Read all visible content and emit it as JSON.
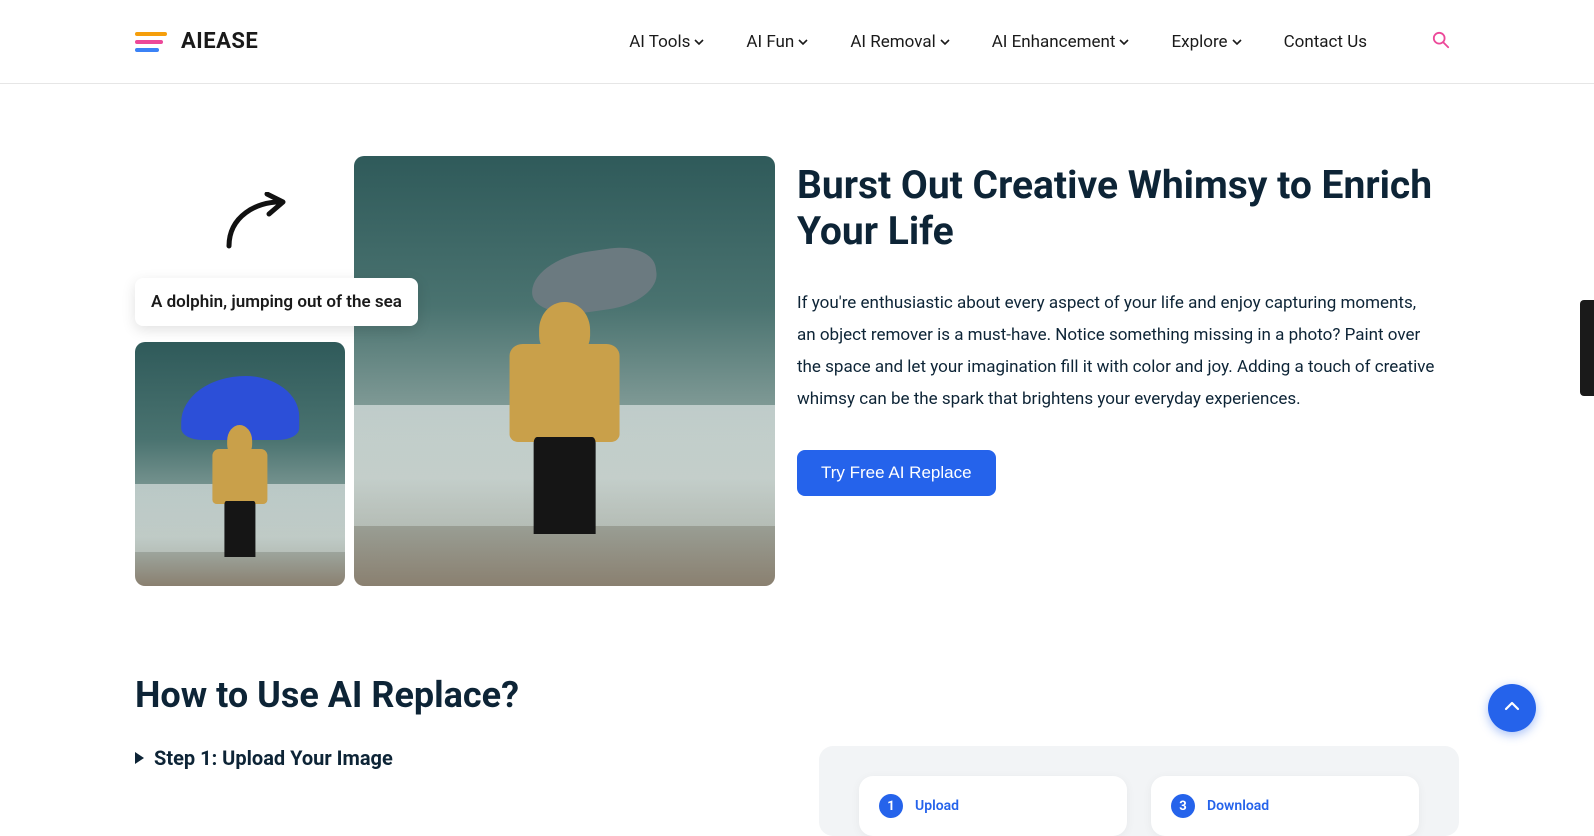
{
  "brand": {
    "name": "AIEASE"
  },
  "nav": {
    "items": [
      {
        "label": "AI Tools"
      },
      {
        "label": "AI Fun"
      },
      {
        "label": "AI Removal"
      },
      {
        "label": "AI Enhancement"
      },
      {
        "label": "Explore"
      }
    ],
    "contact": "Contact Us"
  },
  "hero": {
    "caption": "A dolphin, jumping out of the sea",
    "heading": "Burst Out Creative Whimsy to Enrich Your Life",
    "body": "If you're enthusiastic about every aspect of your life and enjoy capturing moments, an object remover is a must-have. Notice something missing in a photo? Paint over the space and let your imagination fill it with color and joy. Adding a touch of creative whimsy can be the spark that brightens your everyday experiences.",
    "cta": "Try Free AI Replace"
  },
  "howto": {
    "heading": "How to Use AI Replace?",
    "step1": "Step 1: Upload Your Image",
    "cards": [
      {
        "num": "1",
        "label": "Upload"
      },
      {
        "num": "3",
        "label": "Download"
      }
    ]
  }
}
